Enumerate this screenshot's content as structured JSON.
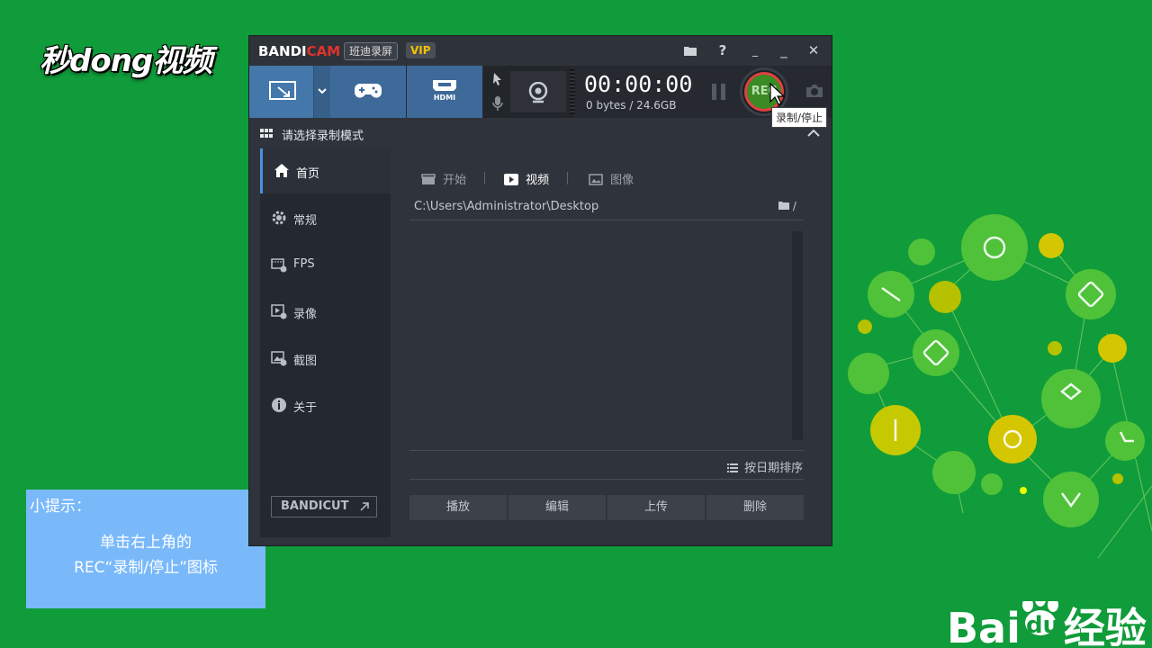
{
  "brand_logo": "秒dong视频",
  "window": {
    "logo_part1": "BANDI",
    "logo_part2": "CAM",
    "badge_cn": "班迪录屏",
    "badge_vip": "VIP",
    "title_buttons": {
      "folder": "folder-icon",
      "help": "?",
      "minimize": "_",
      "close": "✕"
    }
  },
  "toolbar": {
    "modes": [
      {
        "name": "screen-rectangle",
        "icon": "screen-select-icon"
      },
      {
        "name": "game",
        "icon": "gamepad-icon"
      },
      {
        "name": "hdmi",
        "icon": "hdmi-icon",
        "label": "HDMI"
      }
    ],
    "timer": "00:00:00",
    "bytes": "0 bytes / 24.6GB",
    "rec_label": "REC",
    "tooltip": "录制/停止"
  },
  "modebar": {
    "label": "请选择录制模式"
  },
  "sidebar": {
    "items": [
      {
        "label": "首页",
        "icon": "home-icon"
      },
      {
        "label": "常规",
        "icon": "gear-icon"
      },
      {
        "label": "FPS",
        "icon": "fps-icon"
      },
      {
        "label": "录像",
        "icon": "video-record-icon"
      },
      {
        "label": "截图",
        "icon": "screenshot-icon"
      },
      {
        "label": "关于",
        "icon": "info-icon"
      }
    ],
    "bandicut": "BANDICUT"
  },
  "content": {
    "tabs": [
      {
        "label": "开始"
      },
      {
        "label": "视频"
      },
      {
        "label": "图像"
      }
    ],
    "path": "C:\\Users\\Administrator\\Desktop",
    "path_suffix": "/",
    "sort_label": "按日期排序",
    "actions": [
      "播放",
      "编辑",
      "上传",
      "删除"
    ]
  },
  "tip": {
    "title": "小提示：",
    "line1": "单击右上角的",
    "line2": "REC“录制/停止”图标"
  },
  "watermark": {
    "text_left": "Bai",
    "text_mid": "du",
    "text_right": "经验"
  },
  "colors": {
    "background": "#109c3a",
    "mode_blue": "#3d6a98",
    "rec_green": "#3a8a25",
    "rec_red": "#e04040",
    "tip_blue": "#79b9fa"
  }
}
